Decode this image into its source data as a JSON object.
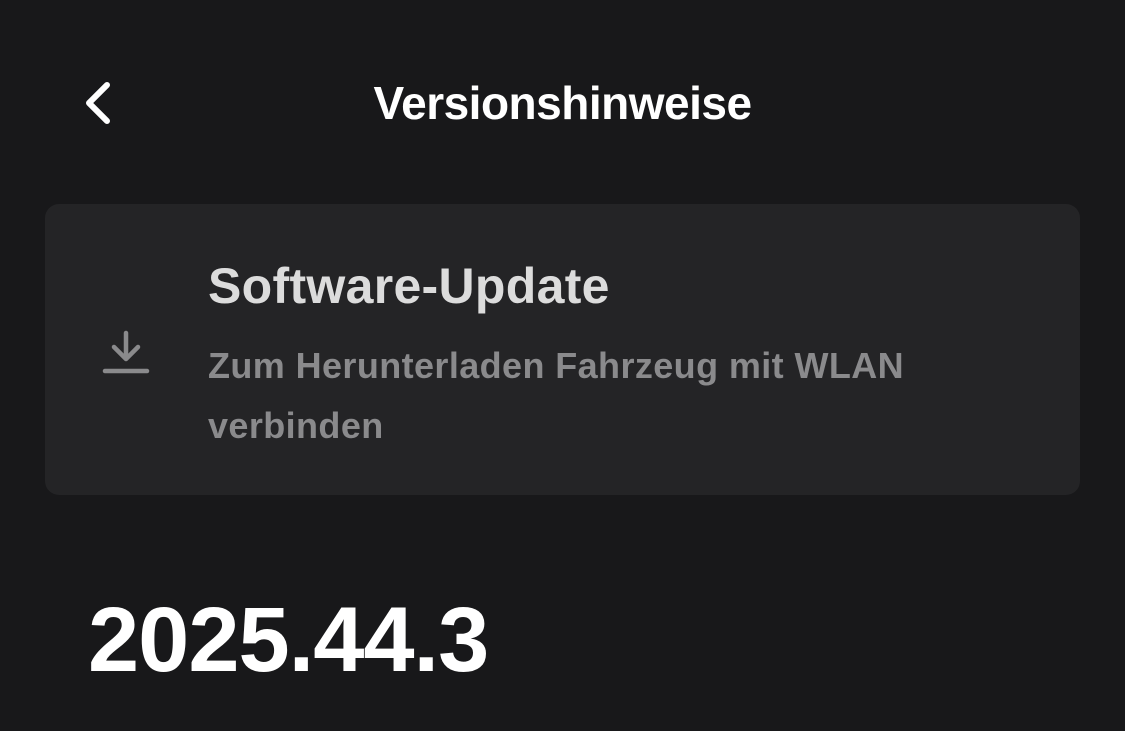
{
  "header": {
    "title": "Versionshinweise",
    "back_icon": "chevron-left-icon"
  },
  "update_card": {
    "icon": "download-icon",
    "title": "Software-Update",
    "subtitle": "Zum Herunterladen Fahrzeug mit WLAN verbinden"
  },
  "release": {
    "version": "2025.44.3"
  },
  "colors": {
    "background": "#18181a",
    "card_background": "#242426",
    "title_text": "#ffffff",
    "card_title_text": "#dcdcdc",
    "muted_text": "#8a8a8c"
  }
}
